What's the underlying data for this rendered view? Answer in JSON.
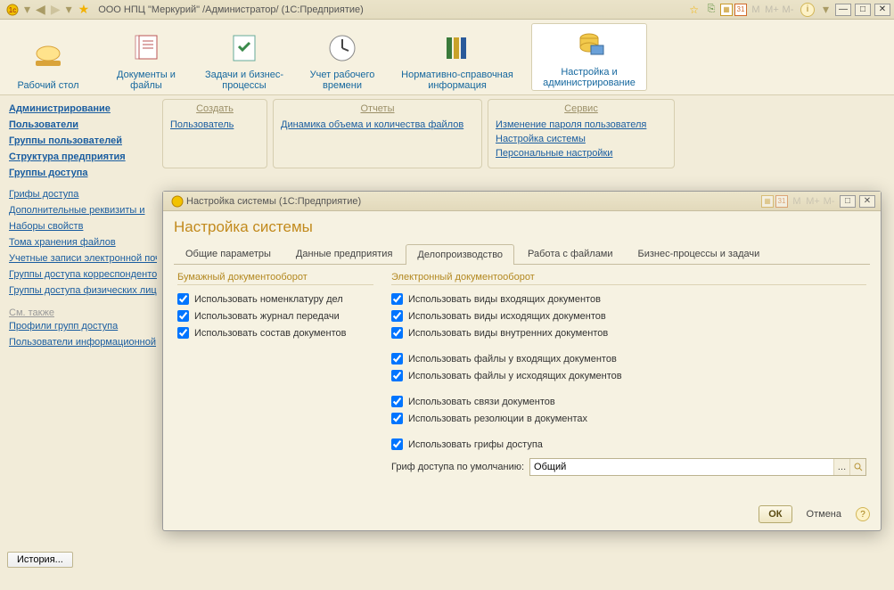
{
  "mainTitle": "ООО НПЦ \"Меркурий\" /Администратор/  (1С:Предприятие)",
  "sections": [
    {
      "label": "Рабочий стол"
    },
    {
      "label": "Документы и файлы"
    },
    {
      "label": "Задачи и бизнес-процессы"
    },
    {
      "label": "Учет рабочего времени"
    },
    {
      "label": "Нормативно-справочная информация"
    },
    {
      "label": "Настройка и администрирование"
    }
  ],
  "sidebar": {
    "bold": [
      "Администрирование",
      "Пользователи",
      "Группы пользователей",
      "Структура предприятия",
      "Группы доступа"
    ],
    "normal": [
      "Грифы доступа",
      "Дополнительные реквизиты и",
      "Наборы свойств",
      "Тома хранения файлов",
      "Учетные записи электронной почты",
      "Группы доступа корреспондентов",
      "Группы доступа физических лиц"
    ],
    "seeAlsoLabel": "См. также",
    "seeAlso": [
      "Профили групп доступа",
      "Пользователи информационной"
    ]
  },
  "panels": {
    "create": {
      "title": "Создать",
      "items": [
        "Пользователь"
      ]
    },
    "reports": {
      "title": "Отчеты",
      "items": [
        "Динамика объема и количества файлов"
      ]
    },
    "service": {
      "title": "Сервис",
      "items": [
        "Изменение пароля пользователя",
        "Настройка системы",
        "Персональные настройки"
      ]
    }
  },
  "dialog": {
    "title": "Настройка системы  (1С:Предприятие)",
    "heading": "Настройка системы",
    "tabs": [
      "Общие параметры",
      "Данные предприятия",
      "Делопроизводство",
      "Работа с файлами",
      "Бизнес-процессы и задачи"
    ],
    "activeTab": "Делопроизводство",
    "paperGroup": "Бумажный документооборот",
    "electronicGroup": "Электронный документооборот",
    "paperChecks": [
      "Использовать номенклатуру дел",
      "Использовать журнал передачи",
      "Использовать состав документов"
    ],
    "electronicChecks": [
      "Использовать виды входящих документов",
      "Использовать виды исходящих документов",
      "Использовать виды внутренних документов",
      "",
      "Использовать файлы у входящих документов",
      "Использовать файлы у исходящих документов",
      "",
      "Использовать связи документов",
      "Использовать резолюции в документах",
      "",
      "Использовать грифы доступа"
    ],
    "defaultGrifLabel": "Гриф доступа по умолчанию:",
    "defaultGrifValue": "Общий",
    "ok": "ОК",
    "cancel": "Отмена"
  },
  "historyLabel": "История...",
  "titlebarLetters": [
    "M",
    "M+",
    "M-"
  ]
}
